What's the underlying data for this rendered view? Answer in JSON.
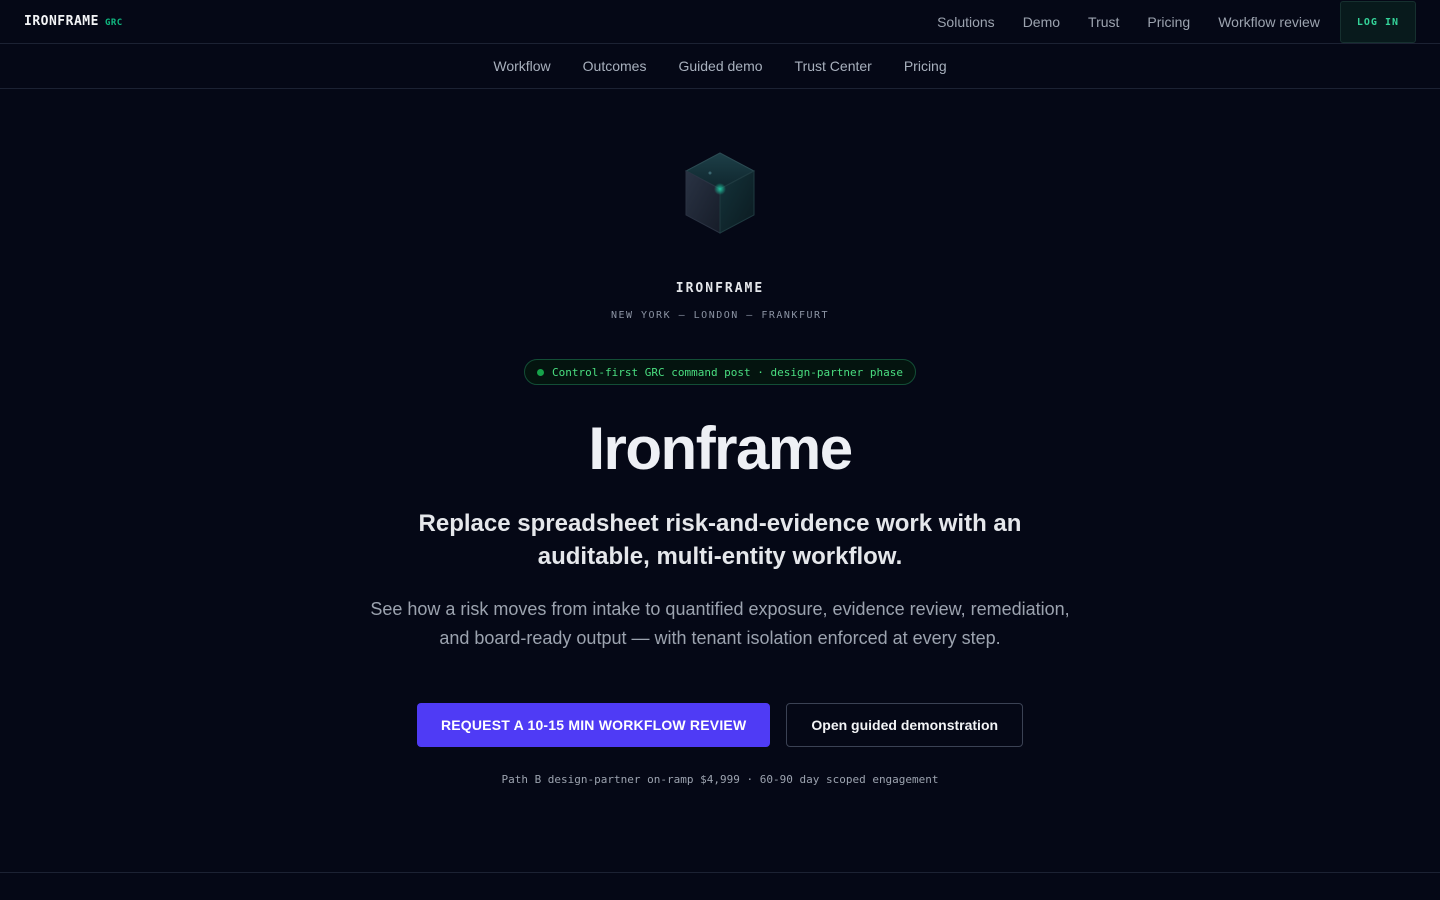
{
  "header": {
    "brand_name": "IRONFRAME",
    "brand_tag": "GRC",
    "nav": [
      "Solutions",
      "Demo",
      "Trust",
      "Pricing",
      "Workflow review"
    ],
    "login_label": "LOG IN"
  },
  "subnav": [
    "Workflow",
    "Outcomes",
    "Guided demo",
    "Trust Center",
    "Pricing"
  ],
  "hero": {
    "company": "IRONFRAME",
    "locations": "NEW YORK — LONDON — FRANKFURT",
    "badge": "Control-first GRC command post · design-partner phase",
    "title": "Ironframe",
    "subtitle": "Replace spreadsheet risk-and-evidence work with an auditable, multi-entity workflow.",
    "description": "See how a risk moves from intake to quantified exposure, evidence review, remediation, and board-ready output — with tenant isolation enforced at every step.",
    "cta_primary": "REQUEST A 10-15 MIN WORKFLOW REVIEW",
    "cta_secondary": "Open guided demonstration",
    "footnote": "Path B design-partner on-ramp $4,999 · 60-90 day scoped engagement"
  },
  "colors": {
    "background": "#050816",
    "accent_green": "#10b981",
    "primary_button": "#4f3bf5"
  },
  "icons": {
    "logo": "cube-icon"
  }
}
